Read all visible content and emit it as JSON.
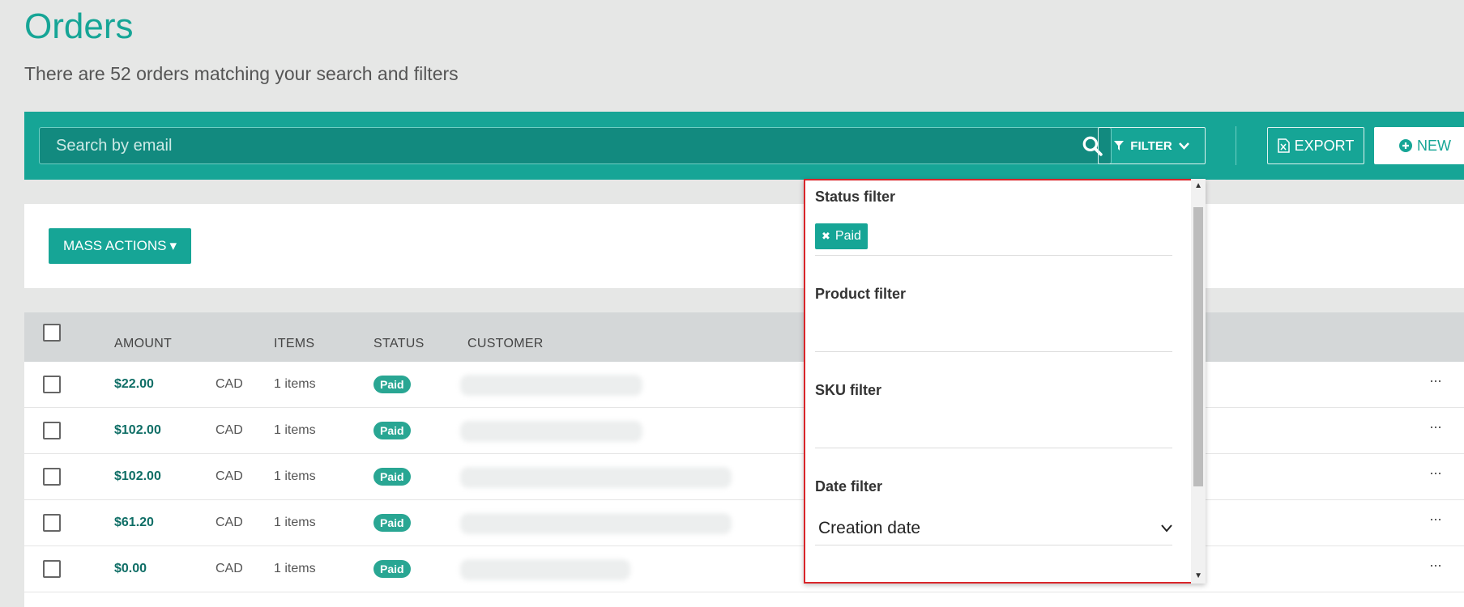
{
  "header": {
    "title": "Orders",
    "subtitle": "There are 52 orders matching your search and filters"
  },
  "toolbar": {
    "search_placeholder": "Search by email",
    "filter_label": "FILTER",
    "export_label": "EXPORT",
    "new_label": "NEW"
  },
  "actions": {
    "mass_actions_label": "MASS ACTIONS"
  },
  "table": {
    "columns": [
      "AMOUNT",
      "ITEMS",
      "STATUS",
      "CUSTOMER"
    ],
    "rows": [
      {
        "amount": "$22.00",
        "currency": "CAD",
        "items": "1 items",
        "status": "Paid",
        "email_blur": 225
      },
      {
        "amount": "$102.00",
        "currency": "CAD",
        "items": "1 items",
        "status": "Paid",
        "email_blur": 225
      },
      {
        "amount": "$102.00",
        "currency": "CAD",
        "items": "1 items",
        "status": "Paid",
        "email_blur": 335
      },
      {
        "amount": "$61.20",
        "currency": "CAD",
        "items": "1 items",
        "status": "Paid",
        "email_blur": 335
      },
      {
        "amount": "$0.00",
        "currency": "CAD",
        "items": "1 items",
        "status": "Paid",
        "email_blur": 210
      }
    ],
    "more_label": "···"
  },
  "filter_panel": {
    "status_label": "Status filter",
    "status_chip": "Paid",
    "product_label": "Product filter",
    "sku_label": "SKU filter",
    "date_label": "Date filter",
    "date_value": "Creation date"
  },
  "colors": {
    "accent": "#16a596",
    "accent_dark": "#128a7f",
    "highlight_outline": "#d9252a"
  }
}
